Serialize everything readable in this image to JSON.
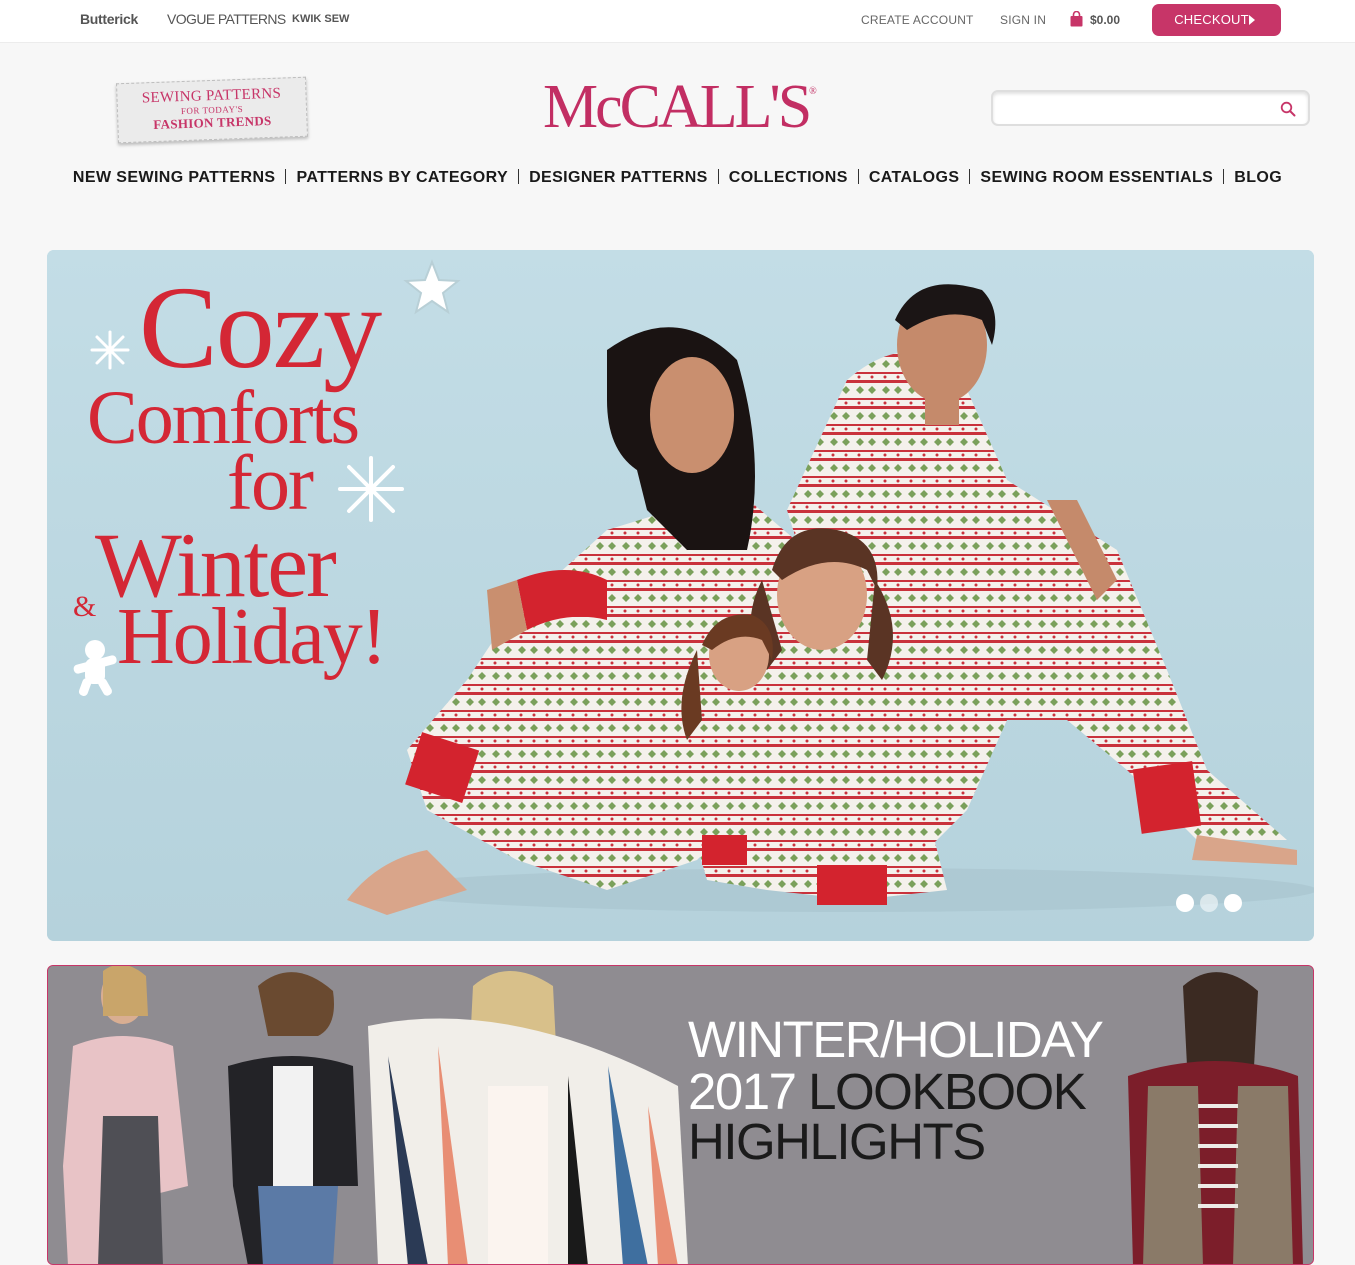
{
  "topbar": {
    "brands": [
      "Butterick",
      "VOGUE PATTERNS",
      "KWIK SEW"
    ],
    "create_account": "CREATE ACCOUNT",
    "sign_in": "SIGN IN",
    "cart_total": "$0.00",
    "checkout": "CHECKOUT",
    "cart_icon": "shopping-bag-icon",
    "checkout_arrow_icon": "caret-right-icon"
  },
  "header": {
    "tagline": {
      "line1": "SEWING PATTERNS",
      "line2": "FOR TODAY'S",
      "line3": "FASHION TRENDS"
    },
    "logo": "McCALL'S",
    "logo_mark": "®",
    "search": {
      "value": "",
      "placeholder": "",
      "icon": "search-icon"
    }
  },
  "nav": {
    "items": [
      "NEW SEWING PATTERNS",
      "PATTERNS BY CATEGORY",
      "DESIGNER PATTERNS",
      "COLLECTIONS",
      "CATALOGS",
      "SEWING ROOM ESSENTIALS",
      "BLOG"
    ]
  },
  "hero": {
    "lines": [
      "Cozy",
      "Comforts",
      "for",
      "Winter",
      "&",
      "Holiday!"
    ],
    "slides": {
      "count": 3,
      "active": 1
    },
    "decor_icons": [
      "star-icon",
      "snowflake-icon",
      "snowflake-icon",
      "gingerbread-icon"
    ]
  },
  "lookbook": {
    "line1": "WINTER/HOLIDAY",
    "line2_a": "2017",
    "line2_b": "LOOKBOOK",
    "line3": "HIGHLIGHTS"
  },
  "colors": {
    "brand_pink": "#c73568",
    "hero_bg": "#c3dde6",
    "hero_text": "#d42735",
    "lookbook_bg": "#8f8c91"
  }
}
